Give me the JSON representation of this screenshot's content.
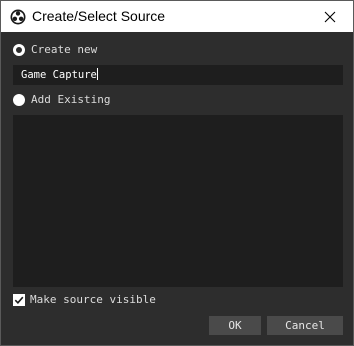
{
  "window": {
    "title": "Create/Select Source"
  },
  "icons": {
    "app": "obs-logo-icon",
    "close": "close-icon",
    "check": "checkmark-icon"
  },
  "options": {
    "create_new_label": "Create new",
    "create_new_selected": true,
    "name_value": "Game Capture",
    "add_existing_label": "Add Existing",
    "add_existing_selected": false,
    "existing_items": []
  },
  "visible": {
    "label": "Make source visible",
    "checked": true
  },
  "buttons": {
    "ok_label": "OK",
    "cancel_label": "Cancel"
  },
  "colors": {
    "background": "#2d2d2d",
    "field_background": "#1e1e1e",
    "button": "#4a4a4a",
    "titlebar": "#ffffff"
  }
}
